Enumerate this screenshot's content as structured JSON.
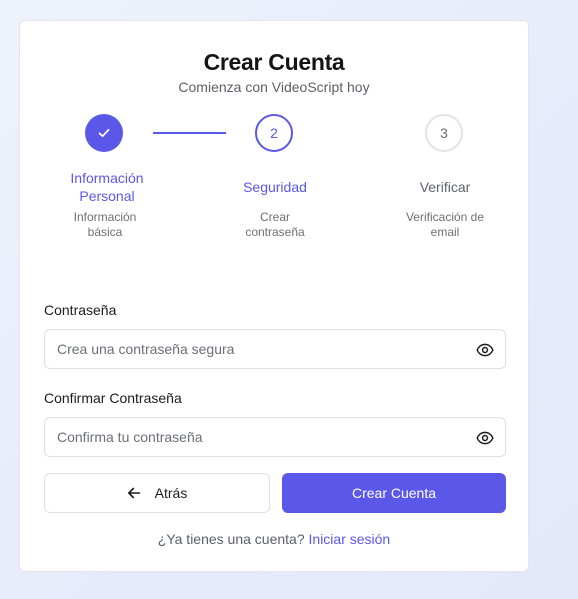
{
  "header": {
    "title": "Crear Cuenta",
    "subtitle": "Comienza con VideoScript hoy"
  },
  "stepper": {
    "steps": [
      {
        "number": "1",
        "title": "Información Personal",
        "description": "Información básica",
        "state": "completed"
      },
      {
        "number": "2",
        "title": "Seguridad",
        "description": "Crear contraseña",
        "state": "active"
      },
      {
        "number": "3",
        "title": "Verificar",
        "description": "Verificación de email",
        "state": "pending"
      }
    ]
  },
  "form": {
    "password": {
      "label": "Contraseña",
      "placeholder": "Crea una contraseña segura",
      "value": ""
    },
    "confirm_password": {
      "label": "Confirmar Contraseña",
      "placeholder": "Confirma tu contraseña",
      "value": ""
    }
  },
  "actions": {
    "back_label": "Atrás",
    "submit_label": "Crear Cuenta"
  },
  "footer": {
    "prompt": "¿Ya tienes una cuenta?",
    "login_link": "Iniciar sesión"
  },
  "colors": {
    "accent": "#5b57e8",
    "background": "#e9edfb",
    "card": "#ffffff",
    "pending_border": "#e1e3e8"
  },
  "icons": {
    "completed_step": "check-icon",
    "password_toggle": "eye-icon",
    "back": "arrow-left-icon"
  }
}
